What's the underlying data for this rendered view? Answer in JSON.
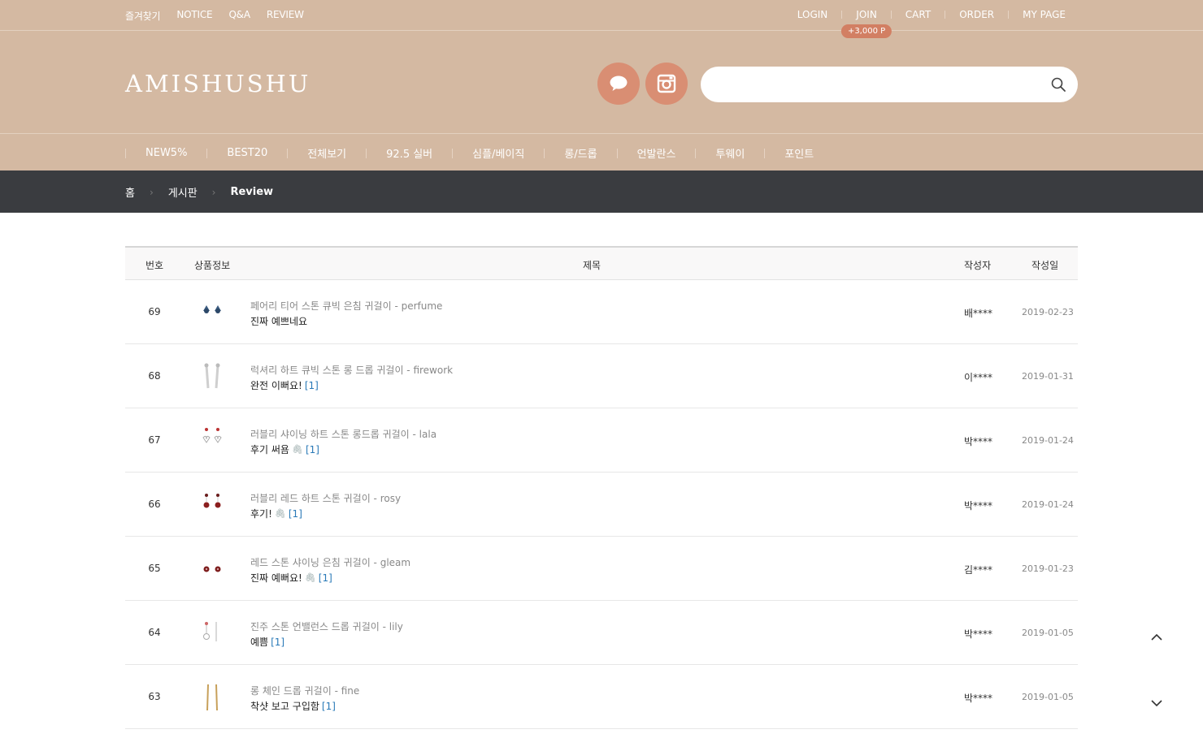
{
  "top_links_left": [
    "즐겨찾기",
    "NOTICE",
    "Q&A",
    "REVIEW"
  ],
  "top_links_right": {
    "login": "LOGIN",
    "join": "JOIN",
    "join_badge": "+3,000 P",
    "cart": "CART",
    "order": "ORDER",
    "mypage": "MY PAGE"
  },
  "logo": "AMISHUSHU",
  "search": {
    "placeholder": "",
    "value": ""
  },
  "gnb": [
    "NEW5%",
    "BEST20",
    "전체보기",
    "92.5 실버",
    "심플/베이직",
    "롱/드롭",
    "언발란스",
    "투웨이",
    "포인트"
  ],
  "breadcrumb": {
    "home": "홈",
    "board": "게시판",
    "current": "Review"
  },
  "table": {
    "headers": {
      "no": "번호",
      "product": "상품정보",
      "subject": "제목",
      "writer": "작성자",
      "date": "작성일"
    },
    "rows": [
      {
        "no": "69",
        "product": "페어리 티어 스톤 큐빅 은침 귀걸이 - perfume",
        "subject": "진짜 예쁘네요",
        "clip": false,
        "comments": "",
        "writer": "배****",
        "date": "2019-02-23",
        "thumb": "teardrop-blue"
      },
      {
        "no": "68",
        "product": "럭셔리 하트 큐빅 스톤 롱 드롭 귀걸이 - firework",
        "subject": "완전 이뻐요!",
        "clip": false,
        "comments": "[1]",
        "writer": "이****",
        "date": "2019-01-31",
        "thumb": "long-silver"
      },
      {
        "no": "67",
        "product": "러블리 샤이닝 하트 스톤 롱드롭 귀걸이 - lala",
        "subject": "후기 써욤",
        "clip": true,
        "comments": "[1]",
        "writer": "박****",
        "date": "2019-01-24",
        "thumb": "heart-outline"
      },
      {
        "no": "66",
        "product": "러블리 레드 하트 스톤 귀걸이 - rosy",
        "subject": "후기!",
        "clip": true,
        "comments": "[1]",
        "writer": "박****",
        "date": "2019-01-24",
        "thumb": "red-drop"
      },
      {
        "no": "65",
        "product": "레드 스톤 샤이닝 은침 귀걸이 - gleam",
        "subject": "진짜 예뻐요!",
        "clip": true,
        "comments": "[1]",
        "writer": "김****",
        "date": "2019-01-23",
        "thumb": "red-stud"
      },
      {
        "no": "64",
        "product": "진주 스톤 언밸런스 드롭 귀걸이 - lily",
        "subject": "예쁨",
        "clip": false,
        "comments": "[1]",
        "writer": "박****",
        "date": "2019-01-05",
        "thumb": "pearl-unbalance"
      },
      {
        "no": "63",
        "product": "롱 체인 드롭 귀걸이 - fine",
        "subject": "착샷 보고 구입함",
        "clip": false,
        "comments": "[1]",
        "writer": "박****",
        "date": "2019-01-05",
        "thumb": "gold-chain"
      }
    ]
  },
  "icons": {
    "talk": "speech-bubble-icon",
    "instagram": "instagram-icon",
    "search": "search-icon",
    "scroll_up": "chevron-up-icon",
    "scroll_down": "chevron-down-icon"
  },
  "colors": {
    "header_bg": "#d4b9a2",
    "accent_circle": "#d98e73",
    "badge": "#d27f63",
    "crumb_bg": "#3a3c40",
    "comment_link": "#2a7ab8"
  }
}
